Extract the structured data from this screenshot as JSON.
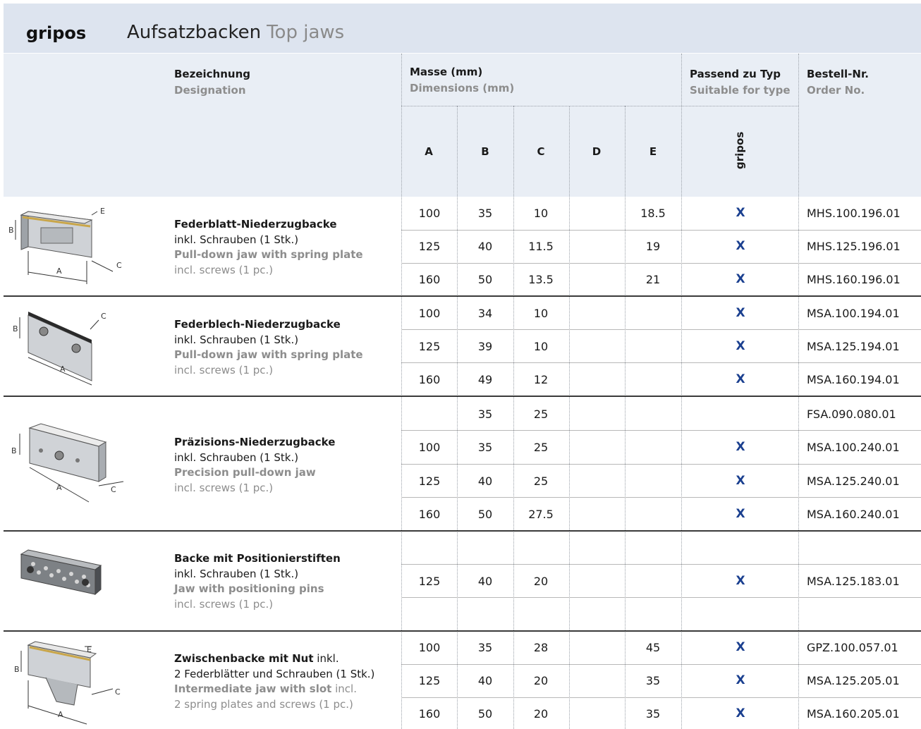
{
  "header": {
    "brand": "gripos",
    "title": "Aufsatzbacken",
    "title_en": "Top jaws"
  },
  "columns": {
    "designation": "Bezeichnung",
    "designation_en": "Designation",
    "dimensions": "Masse (mm)",
    "dimensions_en": "Dimensions (mm)",
    "suitable": "Passend zu Typ",
    "suitable_en": "Suitable for type",
    "order": "Bestell-Nr.",
    "order_en": "Order No.",
    "letters": [
      "A",
      "B",
      "C",
      "D",
      "E"
    ],
    "type_name": "gripos"
  },
  "groups": [
    {
      "name": "Federblatt-Niederzugbacke",
      "incl": "inkl. Schrauben (1 Stk.)",
      "name_en": "Pull-down jaw with spring plate",
      "incl_en": "incl. screws (1 pc.)",
      "rows": [
        {
          "A": "100",
          "B": "35",
          "C": "10",
          "D": "",
          "E": "18.5",
          "fit": "X",
          "order": "MHS.100.196.01"
        },
        {
          "A": "125",
          "B": "40",
          "C": "11.5",
          "D": "",
          "E": "19",
          "fit": "X",
          "order": "MHS.125.196.01"
        },
        {
          "A": "160",
          "B": "50",
          "C": "13.5",
          "D": "",
          "E": "21",
          "fit": "X",
          "order": "MHS.160.196.01"
        }
      ]
    },
    {
      "name": "Federblech-Niederzugbacke",
      "incl": "inkl. Schrauben (1 Stk.)",
      "name_en": "Pull-down jaw with spring plate",
      "incl_en": "incl. screws (1 pc.)",
      "rows": [
        {
          "A": "100",
          "B": "34",
          "C": "10",
          "D": "",
          "E": "",
          "fit": "X",
          "order": "MSA.100.194.01"
        },
        {
          "A": "125",
          "B": "39",
          "C": "10",
          "D": "",
          "E": "",
          "fit": "X",
          "order": "MSA.125.194.01"
        },
        {
          "A": "160",
          "B": "49",
          "C": "12",
          "D": "",
          "E": "",
          "fit": "X",
          "order": "MSA.160.194.01"
        }
      ]
    },
    {
      "name": "Präzisions-Niederzugbacke",
      "incl": "inkl. Schrauben (1 Stk.)",
      "name_en": "Precision pull-down jaw",
      "incl_en": "incl. screws (1 pc.)",
      "rows": [
        {
          "A": "",
          "B": "35",
          "C": "25",
          "D": "",
          "E": "",
          "fit": "",
          "order": "FSA.090.080.01"
        },
        {
          "A": "100",
          "B": "35",
          "C": "25",
          "D": "",
          "E": "",
          "fit": "X",
          "order": "MSA.100.240.01"
        },
        {
          "A": "125",
          "B": "40",
          "C": "25",
          "D": "",
          "E": "",
          "fit": "X",
          "order": "MSA.125.240.01"
        },
        {
          "A": "160",
          "B": "50",
          "C": "27.5",
          "D": "",
          "E": "",
          "fit": "X",
          "order": "MSA.160.240.01"
        }
      ]
    },
    {
      "name": "Backe mit Positionierstiften",
      "incl": "inkl. Schrauben (1 Stk.)",
      "name_en": "Jaw with positioning pins",
      "incl_en": "incl. screws (1 pc.)",
      "rows": [
        {
          "A": "",
          "B": "",
          "C": "",
          "D": "",
          "E": "",
          "fit": "",
          "order": ""
        },
        {
          "A": "125",
          "B": "40",
          "C": "20",
          "D": "",
          "E": "",
          "fit": "X",
          "order": "MSA.125.183.01"
        },
        {
          "A": "",
          "B": "",
          "C": "",
          "D": "",
          "E": "",
          "fit": "",
          "order": ""
        }
      ]
    },
    {
      "name": "Zwischenbacke mit Nut",
      "incl": "inkl.",
      "incl2": "2 Federblätter und Schrauben (1 Stk.)",
      "name_en": "Intermediate jaw with slot",
      "incl_en": "incl.",
      "incl2_en": "2 spring plates and screws (1 pc.)",
      "rows": [
        {
          "A": "100",
          "B": "35",
          "C": "28",
          "D": "",
          "E": "45",
          "fit": "X",
          "order": "GPZ.100.057.01"
        },
        {
          "A": "125",
          "B": "40",
          "C": "20",
          "D": "",
          "E": "35",
          "fit": "X",
          "order": "MSA.125.205.01"
        },
        {
          "A": "160",
          "B": "50",
          "C": "20",
          "D": "",
          "E": "35",
          "fit": "X",
          "order": "MSA.160.205.01"
        }
      ]
    }
  ],
  "drawing_labels": [
    "A",
    "B",
    "C",
    "E"
  ]
}
